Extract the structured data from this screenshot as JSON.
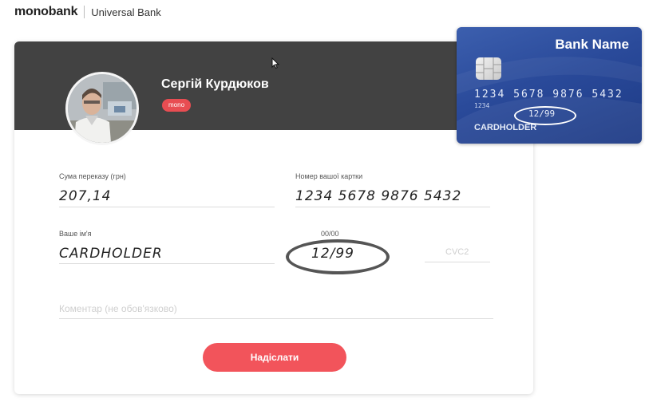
{
  "brand": {
    "logo": "monobank",
    "subtitle": "Universal Bank"
  },
  "recipient": {
    "name": "Сергій Курдюков",
    "badge": "mono"
  },
  "form": {
    "amount_label": "Сума переказу (грн)",
    "amount_value": "207,14",
    "card_label": "Номер вашої картки",
    "card_value": "1234 5678 9876 5432",
    "name_label": "Ваше ім'я",
    "name_value": "CARDHOLDER",
    "expiry_label": "00/00",
    "expiry_value": "12/99",
    "cvc_placeholder": "CVC2",
    "comment_placeholder": "Коментар (не обов'язково)",
    "submit_label": "Надіслати"
  },
  "bank_card": {
    "bank_name": "Bank Name",
    "number": "1234 5678 9876 5432",
    "small_number": "1234",
    "expiry": "12/99",
    "holder": "CARDHOLDER"
  },
  "colors": {
    "accent": "#f2545b",
    "header": "#424242",
    "card_blue": "#2a4a9a"
  },
  "icons": [
    "mouse-cursor-icon",
    "chip-icon"
  ]
}
